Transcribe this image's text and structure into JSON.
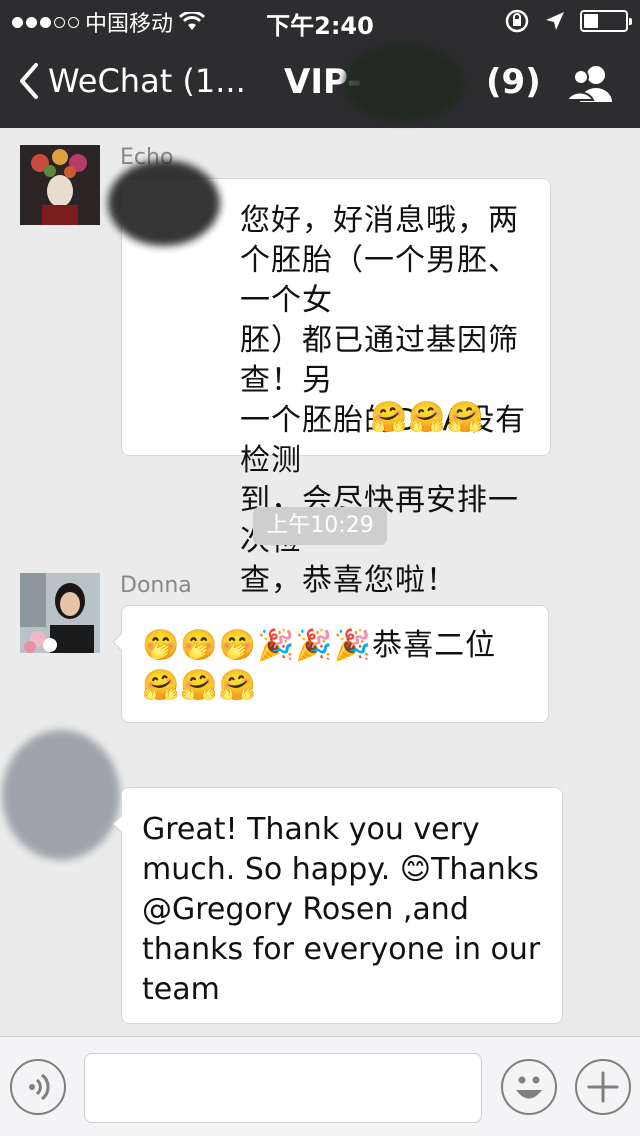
{
  "status_bar": {
    "carrier": "中国移动",
    "time": "下午2:40",
    "battery_level": 0.32
  },
  "nav": {
    "back_label": "WeChat (1...",
    "title": "VIP-",
    "member_count": "(9)"
  },
  "messages": [
    {
      "sender": "Echo",
      "text": "您好，好消息哦，两\n个胚胎（一个男胚、一个女\n胚）都已通过基因筛查！另\n一个胚胎的DNA没有检测\n到，会尽快再安排一次检\n查，恭喜您啦！",
      "emoji": "🤗🤗🤗"
    },
    {
      "sender": "Donna",
      "emoji_line1": "🤭🤭🤭🎉🎉🎉",
      "text": "恭喜二位",
      "emoji_line2": "🤗🤗🤗"
    },
    {
      "sender": "",
      "text1": "Great! Thank you very\nmuch. So happy. ",
      "emoji": "😊",
      "text2": "Thanks\n@Gregory Rosen ,and\nthanks for everyone in our\nteam"
    }
  ],
  "timestamp": "上午10:29",
  "input": {
    "placeholder": ""
  },
  "icons": {
    "voice": "voice-icon",
    "emoji": "emoji-icon",
    "add": "plus-icon",
    "group": "group-icon",
    "back": "chevron-left-icon"
  }
}
